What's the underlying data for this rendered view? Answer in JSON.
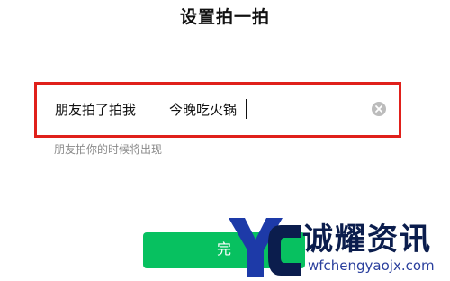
{
  "header": {
    "title": "设置拍一拍"
  },
  "input": {
    "prefix": "朋友拍了拍我",
    "value": "今晚吃火锅",
    "clear_icon": "clear-circle-icon"
  },
  "hint": "朋友拍你的时候将出现",
  "footer": {
    "done_label": "完"
  },
  "watermark": {
    "logo": "yc-logo",
    "name": "诚耀资讯",
    "domain": "wfchengyaojx.com"
  },
  "colors": {
    "highlight_border": "#e0201b",
    "primary_green": "#07c160",
    "watermark_navy": "#0b1d4d",
    "watermark_blue": "#2a3f9d"
  }
}
